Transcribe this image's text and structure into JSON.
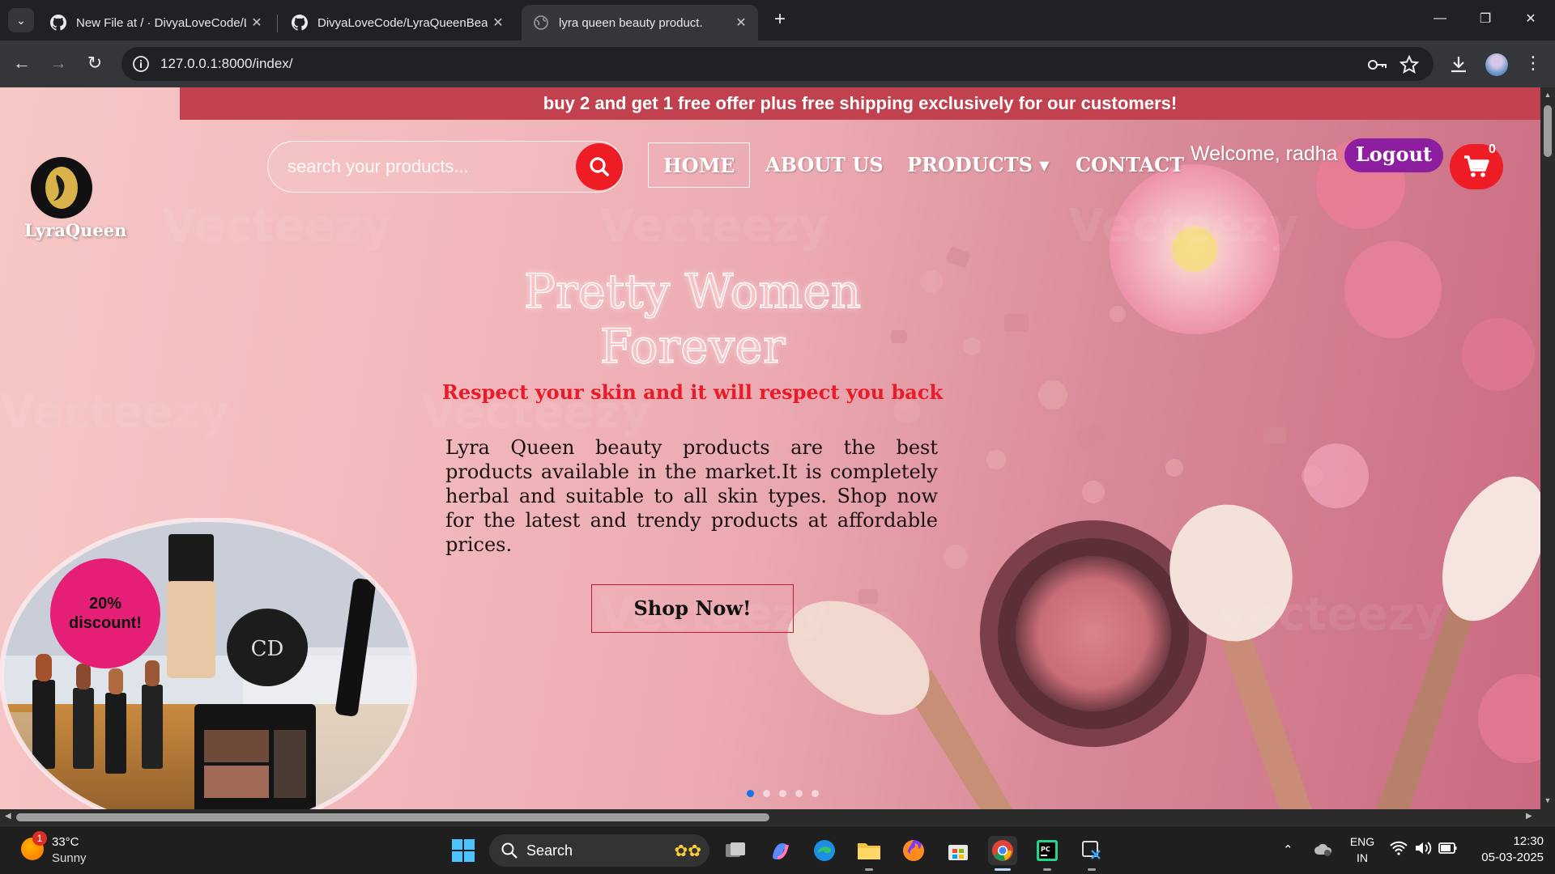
{
  "browser": {
    "tabs": [
      {
        "title": "New File at / · DivyaLoveCode/LyraQueenBeauty",
        "icon": "github-icon"
      },
      {
        "title": "DivyaLoveCode/LyraQueenBeauty",
        "icon": "github-icon"
      },
      {
        "title": "lyra queen beauty product.",
        "icon": "globe-icon",
        "active": true
      }
    ],
    "url": "127.0.0.1:8000/index/"
  },
  "promo": {
    "text": "buy 2 and get 1 free offer plus free shipping exclusively for our customers!"
  },
  "site": {
    "brand": "LyraQueen",
    "search_placeholder": "search your products...",
    "nav": [
      {
        "label": "HOME",
        "active": true
      },
      {
        "label": "ABOUT US"
      },
      {
        "label": "PRODUCTS",
        "dropdown": true
      },
      {
        "label": "CONTACT"
      }
    ],
    "welcome": "Welcome, radha",
    "logout": "Logout",
    "cart_count": "0"
  },
  "hero": {
    "title_line1": "Pretty Women",
    "title_line2": "Forever",
    "subtitle": "Respect your skin and it will respect you back",
    "paragraph": "Lyra Queen beauty products are the best products available in the market.It is completely herbal and suitable to all skin types. Shop now for the latest and trendy products at affordable prices.",
    "cta": "Shop Now!",
    "discount_line1": "20%",
    "discount_line2": "discount!",
    "carousel_dots": 5,
    "carousel_active": 0
  },
  "taskbar": {
    "weather_temp": "33°C",
    "weather_desc": "Sunny",
    "weather_badge": "1",
    "search_label": "Search",
    "lang_line1": "ENG",
    "lang_line2": "IN",
    "time": "12:30",
    "date": "05-03-2025"
  },
  "colors": {
    "promo_bar": "#c2414f",
    "accent_red": "#ee1c25",
    "logout_purple": "#8d1ea0",
    "badge_pink": "#e51f76"
  }
}
